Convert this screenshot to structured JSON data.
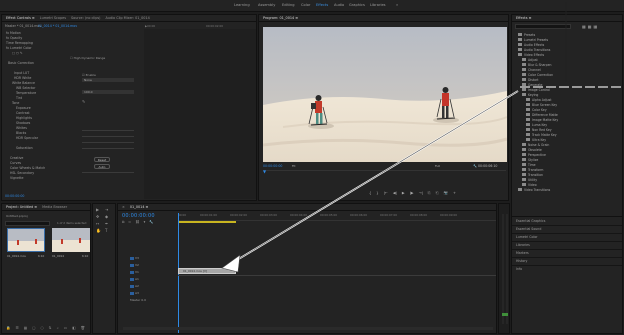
{
  "workspaces": {
    "learning": "Learning",
    "assembly": "Assembly",
    "editing": "Editing",
    "color": "Color",
    "effects": "Effects",
    "audio": "Audio",
    "graphics": "Graphics",
    "libraries": "Libraries",
    "overflow": "»"
  },
  "left_panel": {
    "tabs": [
      "Effect Controls ≡",
      "Lumetri Scopes",
      "Source: (no clips)",
      "Audio Clip Mixer: 01_0014"
    ],
    "master_label": "Master * 01_0014.mov",
    "clip_label": "01_0014 * 01_0014.mov",
    "timecode_ruler": [
      "▶00:00",
      "00:00:02:00"
    ],
    "rows": [
      "fx Motion",
      "fx Opacity",
      "Time Remapping",
      "fx Lumetri Color",
      "□ ○ ✎",
      "Basic Correction",
      "Input LUT",
      "HDR White",
      "White Balance",
      "WB Selector",
      "Temperature",
      "Tint",
      "Tone",
      "Exposure",
      "Contrast",
      "Highlights",
      "Shadows",
      "Whites",
      "Blacks",
      "HDR Specular",
      "Saturation",
      "Creative",
      "Curves",
      "Color Wheels & Match",
      "HSL Secondary",
      "Vignette"
    ],
    "reset_label": "Reset",
    "auto_label": "Auto",
    "high_dynamic_range": "High Dynamic Range",
    "none_label": "None",
    "enable_label": "Enable",
    "basic_label": "Basic",
    "value_100": "100.0",
    "timecode": "00:00:00:00"
  },
  "program_monitor": {
    "title": "Program: 01_0014 ≡",
    "timecode_left": "00:00:00:00",
    "fit": "Fit",
    "full": "Full",
    "timecode_right": "00:00:06:10",
    "transport": [
      "{",
      "}",
      "|←",
      "◀|",
      "▶",
      "|▶",
      "→|",
      "⎘",
      "⎗",
      "📷",
      "+"
    ]
  },
  "effects_panel": {
    "title": "Effects ≡",
    "search_placeholder": "",
    "items": [
      {
        "label": "Presets",
        "indent": 0
      },
      {
        "label": "Lumetri Presets",
        "indent": 0
      },
      {
        "label": "Audio Effects",
        "indent": 0
      },
      {
        "label": "Audio Transitions",
        "indent": 0
      },
      {
        "label": "Video Effects",
        "indent": 0
      },
      {
        "label": "Adjust",
        "indent": 1
      },
      {
        "label": "Blur & Sharpen",
        "indent": 1
      },
      {
        "label": "Channel",
        "indent": 1
      },
      {
        "label": "Color Correction",
        "indent": 1
      },
      {
        "label": "Distort",
        "indent": 1
      },
      {
        "label": "Generate",
        "indent": 1
      },
      {
        "label": "Image Control",
        "indent": 1
      },
      {
        "label": "Keying",
        "indent": 1
      },
      {
        "label": "Alpha Adjust",
        "indent": 2
      },
      {
        "label": "Blue Screen Key",
        "indent": 2
      },
      {
        "label": "Color Key",
        "indent": 2
      },
      {
        "label": "Difference Matte",
        "indent": 2
      },
      {
        "label": "Image Matte Key",
        "indent": 2
      },
      {
        "label": "Luma Key",
        "indent": 2
      },
      {
        "label": "Non Red Key",
        "indent": 2
      },
      {
        "label": "Track Matte Key",
        "indent": 2
      },
      {
        "label": "Ultra Key",
        "indent": 2
      },
      {
        "label": "Noise & Grain",
        "indent": 1
      },
      {
        "label": "Obsolete",
        "indent": 1
      },
      {
        "label": "Perspective",
        "indent": 1
      },
      {
        "label": "Stylize",
        "indent": 1
      },
      {
        "label": "Time",
        "indent": 1
      },
      {
        "label": "Transform",
        "indent": 1
      },
      {
        "label": "Transition",
        "indent": 1
      },
      {
        "label": "Utility",
        "indent": 1
      },
      {
        "label": "Video",
        "indent": 1
      },
      {
        "label": "Video Transitions",
        "indent": 0
      }
    ],
    "bottom_panels": [
      "Essential Graphics",
      "Essential Sound",
      "Lumetri Color",
      "Libraries",
      "Markers",
      "History",
      "Info"
    ]
  },
  "project_panel": {
    "title": "Project: Untitled ≡",
    "tab2": "Media Browser",
    "file_label": "Untitled.prproj",
    "count": "1 of 2 items selected",
    "items": [
      {
        "name": "01_0014.mov",
        "duration": "6:10"
      },
      {
        "name": "01_0014",
        "duration": "6:10"
      }
    ]
  },
  "timeline": {
    "title": "01_0014 ≡",
    "timecode": "00:00:00:00",
    "ruler": [
      "00:00",
      "00:00:01:00",
      "00:00:02:00",
      "00:00:03:00",
      "00:00:04:00",
      "00:00:05:00",
      "00:00:06:00",
      "00:00:07:00",
      "00:00:08:00",
      "00:00:09:00"
    ],
    "tracks": [
      "V3",
      "V2",
      "V1",
      "A1",
      "A2",
      "A3",
      "Master"
    ],
    "master_value": "0.0",
    "clip_label": "01_0014.mov [V]"
  },
  "colors": {
    "accent": "#2e8ae6",
    "clip": "#a6a6a6",
    "sky": "#b7bcc5",
    "snow": "#ece3d3"
  }
}
